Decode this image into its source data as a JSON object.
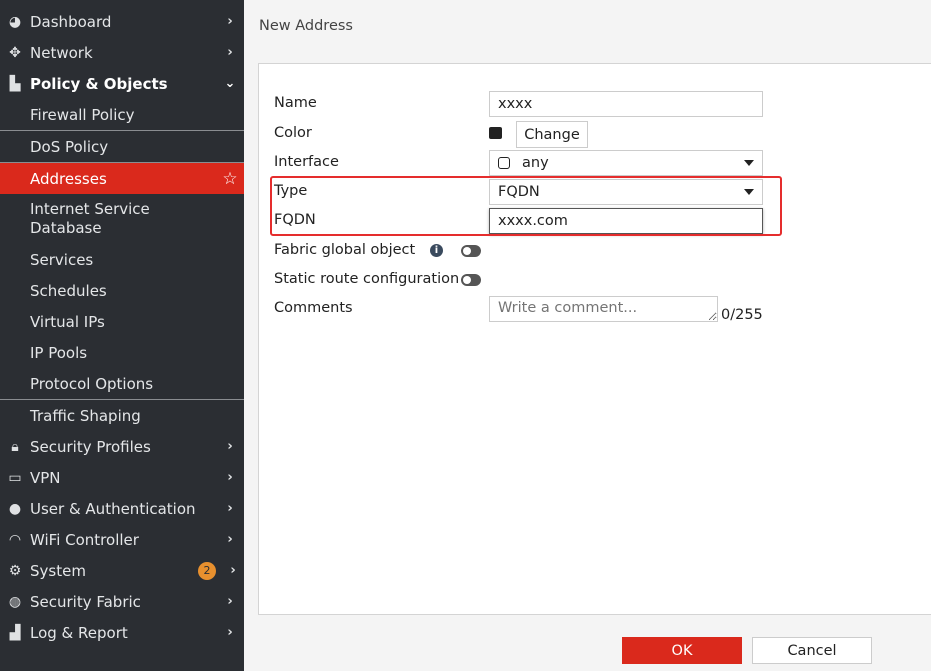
{
  "sidebar": {
    "items": [
      {
        "label": "Dashboard",
        "icon": "dashboard-icon"
      },
      {
        "label": "Network",
        "icon": "network-icon"
      },
      {
        "label": "Policy & Objects",
        "icon": "policy-icon"
      },
      {
        "label": "Firewall Policy"
      },
      {
        "label": "DoS Policy"
      },
      {
        "label": "Addresses"
      },
      {
        "label": "Internet Service Database"
      },
      {
        "label": "Services"
      },
      {
        "label": "Schedules"
      },
      {
        "label": "Virtual IPs"
      },
      {
        "label": "IP Pools"
      },
      {
        "label": "Protocol Options"
      },
      {
        "label": "Traffic Shaping"
      },
      {
        "label": "Security Profiles",
        "icon": "lock-icon"
      },
      {
        "label": "VPN",
        "icon": "laptop-icon"
      },
      {
        "label": "User & Authentication",
        "icon": "user-icon"
      },
      {
        "label": "WiFi Controller",
        "icon": "wifi-icon"
      },
      {
        "label": "System",
        "icon": "gear-icon",
        "badge": "2"
      },
      {
        "label": "Security Fabric",
        "icon": "fabric-icon"
      },
      {
        "label": "Log & Report",
        "icon": "chart-icon"
      }
    ],
    "active_color": "#da291c",
    "badge_color": "#e8902e"
  },
  "page": {
    "title": "New Address"
  },
  "form": {
    "name_label": "Name",
    "name_value": "xxxx",
    "color_label": "Color",
    "change_label": "Change",
    "interface_label": "Interface",
    "interface_value": "any",
    "type_label": "Type",
    "type_value": "FQDN",
    "fqdn_label": "FQDN",
    "fqdn_value": "xxxx.com",
    "fabric_label": "Fabric global object",
    "fabric_enabled": false,
    "static_label": "Static route configuration",
    "static_enabled": false,
    "comments_label": "Comments",
    "comments_placeholder": "Write a comment...",
    "comments_count": "0/255"
  },
  "footer": {
    "ok": "OK",
    "cancel": "Cancel"
  }
}
